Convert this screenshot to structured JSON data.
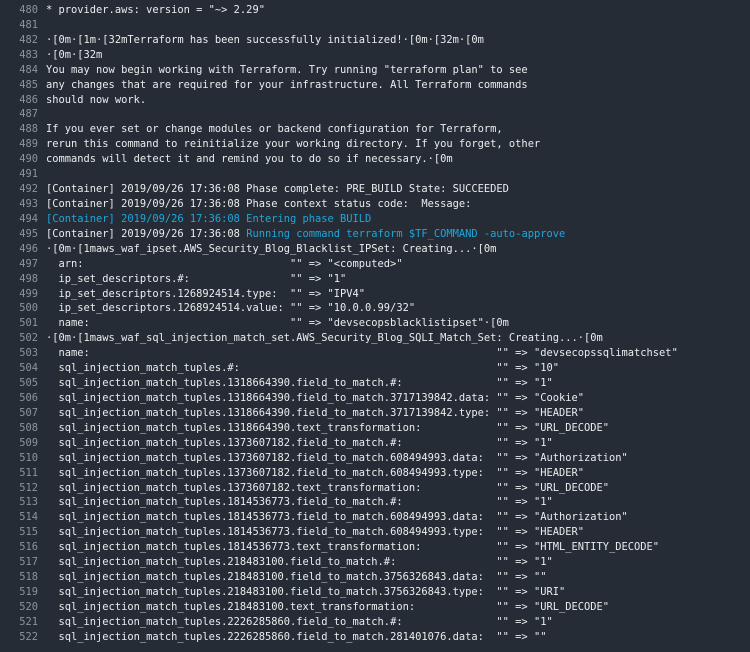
{
  "colors": {
    "background": "#252c35",
    "text": "#eaeded",
    "line_number": "#8b949e",
    "highlight": "#1ea7db"
  },
  "lines": [
    {
      "n": "480",
      "text": "* provider.aws: version = \"~> 2.29\""
    },
    {
      "n": "481",
      "text": ""
    },
    {
      "n": "482",
      "text": "·[0m·[1m·[32mTerraform has been successfully initialized!·[0m·[32m·[0m"
    },
    {
      "n": "483",
      "text": "·[0m·[32m"
    },
    {
      "n": "484",
      "text": "You may now begin working with Terraform. Try running \"terraform plan\" to see"
    },
    {
      "n": "485",
      "text": "any changes that are required for your infrastructure. All Terraform commands"
    },
    {
      "n": "486",
      "text": "should now work."
    },
    {
      "n": "487",
      "text": ""
    },
    {
      "n": "488",
      "text": "If you ever set or change modules or backend configuration for Terraform,"
    },
    {
      "n": "489",
      "text": "rerun this command to reinitialize your working directory. If you forget, other"
    },
    {
      "n": "490",
      "text": "commands will detect it and remind you to do so if necessary.·[0m"
    },
    {
      "n": "491",
      "text": ""
    },
    {
      "n": "492",
      "text": "[Container] 2019/09/26 17:36:08 Phase complete: PRE_BUILD State: SUCCEEDED"
    },
    {
      "n": "493",
      "text": "[Container] 2019/09/26 17:36:08 Phase context status code:  Message:"
    },
    {
      "n": "494",
      "cyan": "[Container] 2019/09/26 17:36:08 Entering phase BUILD"
    },
    {
      "n": "495",
      "text": "[Container] 2019/09/26 17:36:08 ",
      "cyan": "Running command terraform $TF_COMMAND -auto-approve"
    },
    {
      "n": "496",
      "text": "·[0m·[1maws_waf_ipset.AWS_Security_Blog_Blacklist_IPSet: Creating...·[0m"
    },
    {
      "n": "497",
      "group": "ipset",
      "key": "  arn:",
      "val": "\"\" => \"<computed>\""
    },
    {
      "n": "498",
      "group": "ipset",
      "key": "  ip_set_descriptors.#:",
      "val": "\"\" => \"1\""
    },
    {
      "n": "499",
      "group": "ipset",
      "key": "  ip_set_descriptors.1268924514.type:",
      "val": "\"\" => \"IPV4\""
    },
    {
      "n": "500",
      "group": "ipset",
      "key": "  ip_set_descriptors.1268924514.value:",
      "val": "\"\" => \"10.0.0.99/32\""
    },
    {
      "n": "501",
      "group": "ipset",
      "key": "  name:",
      "val": "\"\" => \"devsecopsblacklistipset\"·[0m"
    },
    {
      "n": "502",
      "text": "·[0m·[1maws_waf_sql_injection_match_set.AWS_Security_Blog_SQLI_Match_Set: Creating...·[0m"
    },
    {
      "n": "503",
      "group": "sqli",
      "key": "  name:",
      "val": "\"\" => \"devsecopssqlimatchset\""
    },
    {
      "n": "504",
      "group": "sqli",
      "key": "  sql_injection_match_tuples.#:",
      "val": "\"\" => \"10\""
    },
    {
      "n": "505",
      "group": "sqli",
      "key": "  sql_injection_match_tuples.1318664390.field_to_match.#:",
      "val": "\"\" => \"1\""
    },
    {
      "n": "506",
      "group": "sqli",
      "key": "  sql_injection_match_tuples.1318664390.field_to_match.3717139842.data:",
      "val": "\"\" => \"Cookie\""
    },
    {
      "n": "507",
      "group": "sqli",
      "key": "  sql_injection_match_tuples.1318664390.field_to_match.3717139842.type:",
      "val": "\"\" => \"HEADER\""
    },
    {
      "n": "508",
      "group": "sqli",
      "key": "  sql_injection_match_tuples.1318664390.text_transformation:",
      "val": "\"\" => \"URL_DECODE\""
    },
    {
      "n": "509",
      "group": "sqli",
      "key": "  sql_injection_match_tuples.1373607182.field_to_match.#:",
      "val": "\"\" => \"1\""
    },
    {
      "n": "510",
      "group": "sqli",
      "key": "  sql_injection_match_tuples.1373607182.field_to_match.608494993.data:",
      "val": "\"\" => \"Authorization\""
    },
    {
      "n": "511",
      "group": "sqli",
      "key": "  sql_injection_match_tuples.1373607182.field_to_match.608494993.type:",
      "val": "\"\" => \"HEADER\""
    },
    {
      "n": "512",
      "group": "sqli",
      "key": "  sql_injection_match_tuples.1373607182.text_transformation:",
      "val": "\"\" => \"URL_DECODE\""
    },
    {
      "n": "513",
      "group": "sqli",
      "key": "  sql_injection_match_tuples.1814536773.field_to_match.#:",
      "val": "\"\" => \"1\""
    },
    {
      "n": "514",
      "group": "sqli",
      "key": "  sql_injection_match_tuples.1814536773.field_to_match.608494993.data:",
      "val": "\"\" => \"Authorization\""
    },
    {
      "n": "515",
      "group": "sqli",
      "key": "  sql_injection_match_tuples.1814536773.field_to_match.608494993.type:",
      "val": "\"\" => \"HEADER\""
    },
    {
      "n": "516",
      "group": "sqli",
      "key": "  sql_injection_match_tuples.1814536773.text_transformation:",
      "val": "\"\" => \"HTML_ENTITY_DECODE\""
    },
    {
      "n": "517",
      "group": "sqli",
      "key": "  sql_injection_match_tuples.218483100.field_to_match.#:",
      "val": "\"\" => \"1\""
    },
    {
      "n": "518",
      "group": "sqli",
      "key": "  sql_injection_match_tuples.218483100.field_to_match.3756326843.data:",
      "val": "\"\" => \"\""
    },
    {
      "n": "519",
      "group": "sqli",
      "key": "  sql_injection_match_tuples.218483100.field_to_match.3756326843.type:",
      "val": "\"\" => \"URI\""
    },
    {
      "n": "520",
      "group": "sqli",
      "key": "  sql_injection_match_tuples.218483100.text_transformation:",
      "val": "\"\" => \"URL_DECODE\""
    },
    {
      "n": "521",
      "group": "sqli",
      "key": "  sql_injection_match_tuples.2226285860.field_to_match.#:",
      "val": "\"\" => \"1\""
    },
    {
      "n": "522",
      "group": "sqli",
      "key": "  sql_injection_match_tuples.2226285860.field_to_match.281401076.data:",
      "val": "\"\" => \"\""
    }
  ]
}
